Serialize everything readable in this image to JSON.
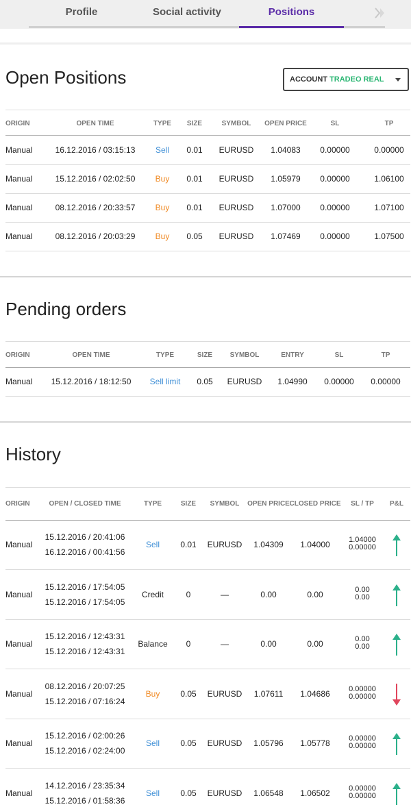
{
  "tabs": [
    {
      "label": "Profile"
    },
    {
      "label": "Social activity"
    },
    {
      "label": "Positions"
    }
  ],
  "open_positions": {
    "title": "Open Positions",
    "account_select": {
      "prefix": "ACCOUNT",
      "value": "TRADEO REAL"
    },
    "headers": [
      "ORIGIN",
      "OPEN TIME",
      "TYPE",
      "SIZE",
      "SYMBOL",
      "OPEN PRICE",
      "SL",
      "TP"
    ],
    "rows": [
      [
        "Manual",
        "16.12.2016 / 03:15:13",
        "Sell",
        "0.01",
        "EURUSD",
        "1.04083",
        "0.00000",
        "0.00000"
      ],
      [
        "Manual",
        "15.12.2016 / 02:02:50",
        "Buy",
        "0.01",
        "EURUSD",
        "1.05979",
        "0.00000",
        "1.06100"
      ],
      [
        "Manual",
        "08.12.2016 / 20:33:57",
        "Buy",
        "0.01",
        "EURUSD",
        "1.07000",
        "0.00000",
        "1.07100"
      ],
      [
        "Manual",
        "08.12.2016 / 20:03:29",
        "Buy",
        "0.05",
        "EURUSD",
        "1.07469",
        "0.00000",
        "1.07500"
      ]
    ]
  },
  "pending_orders": {
    "title": "Pending orders",
    "headers": [
      "ORIGIN",
      "OPEN TIME",
      "TYPE",
      "SIZE",
      "SYMBOL",
      "ENTRY",
      "SL",
      "TP"
    ],
    "rows": [
      [
        "Manual",
        "15.12.2016 / 18:12:50",
        "Sell limit",
        "0.05",
        "EURUSD",
        "1.04990",
        "0.00000",
        "0.00000"
      ]
    ]
  },
  "history": {
    "title": "History",
    "headers": [
      "ORIGIN",
      "OPEN / CLOSED TIME",
      "TYPE",
      "SIZE",
      "SYMBOL",
      "OPEN PRICE",
      "CLOSED PRICE",
      "SL / TP",
      "P&L"
    ],
    "rows": [
      {
        "origin": "Manual",
        "open_time": "15.12.2016 / 20:41:06",
        "closed_time": "16.12.2016 / 00:41:56",
        "type": "Sell",
        "size": "0.01",
        "symbol": "EURUSD",
        "open_price": "1.04309",
        "closed_price": "1.04000",
        "sl": "1.04000",
        "tp": "0.00000",
        "pnl": "up"
      },
      {
        "origin": "Manual",
        "open_time": "15.12.2016 / 17:54:05",
        "closed_time": "15.12.2016 / 17:54:05",
        "type": "Credit",
        "size": "0",
        "symbol": "—",
        "open_price": "0.00",
        "closed_price": "0.00",
        "sl": "0.00",
        "tp": "0.00",
        "pnl": "up"
      },
      {
        "origin": "Manual",
        "open_time": "15.12.2016 / 12:43:31",
        "closed_time": "15.12.2016 / 12:43:31",
        "type": "Balance",
        "size": "0",
        "symbol": "—",
        "open_price": "0.00",
        "closed_price": "0.00",
        "sl": "0.00",
        "tp": "0.00",
        "pnl": "up"
      },
      {
        "origin": "Manual",
        "open_time": "08.12.2016 / 20:07:25",
        "closed_time": "15.12.2016 / 07:16:24",
        "type": "Buy",
        "size": "0.05",
        "symbol": "EURUSD",
        "open_price": "1.07611",
        "closed_price": "1.04686",
        "sl": "0.00000",
        "tp": "0.00000",
        "pnl": "down"
      },
      {
        "origin": "Manual",
        "open_time": "15.12.2016 / 02:00:26",
        "closed_time": "15.12.2016 / 02:24:00",
        "type": "Sell",
        "size": "0.05",
        "symbol": "EURUSD",
        "open_price": "1.05796",
        "closed_price": "1.05778",
        "sl": "0.00000",
        "tp": "0.00000",
        "pnl": "up"
      },
      {
        "origin": "Manual",
        "open_time": "14.12.2016 / 23:35:34",
        "closed_time": "15.12.2016 / 01:58:36",
        "type": "Sell",
        "size": "0.05",
        "symbol": "EURUSD",
        "open_price": "1.06548",
        "closed_price": "1.06502",
        "sl": "0.00000",
        "tp": "0.00000",
        "pnl": "up"
      }
    ]
  },
  "colors": {
    "accent": "#5b2ca8",
    "sell": "#3f8fd6",
    "buy": "#f08a24",
    "up": "#2bb08a",
    "down": "#e0455c",
    "account_value": "#2bb673"
  }
}
